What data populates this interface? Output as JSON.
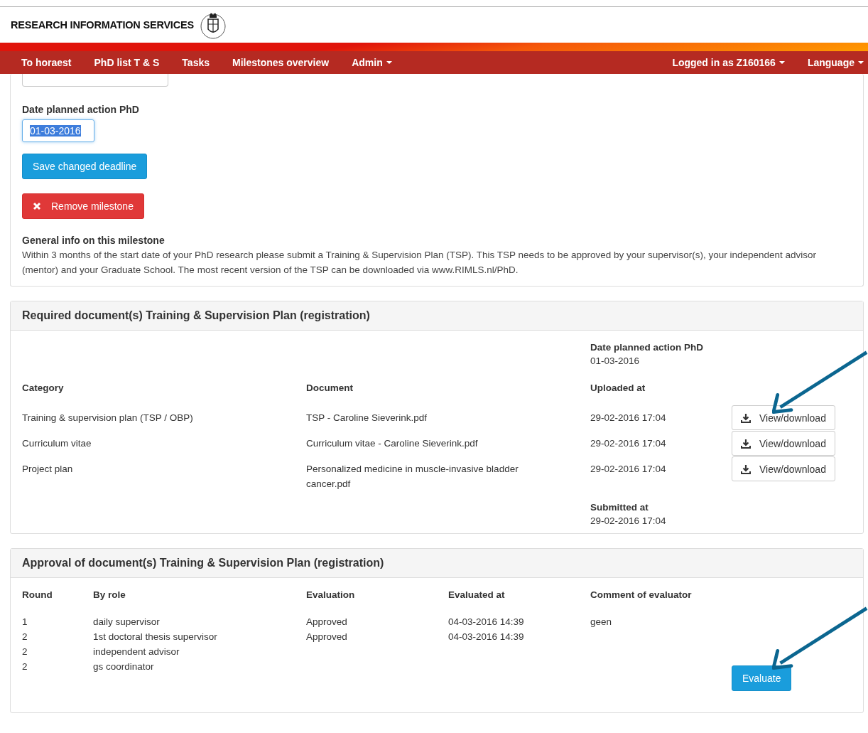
{
  "header": {
    "title": "RESEARCH INFORMATION SERVICES"
  },
  "nav": {
    "left": [
      {
        "label": "To horaest",
        "dropdown": false
      },
      {
        "label": "PhD list T & S",
        "dropdown": false
      },
      {
        "label": "Tasks",
        "dropdown": false
      },
      {
        "label": "Milestones overview",
        "dropdown": false
      },
      {
        "label": "Admin",
        "dropdown": true
      }
    ],
    "right": [
      {
        "label": "Logged in as Z160166",
        "dropdown": true
      },
      {
        "label": "Language",
        "dropdown": true
      }
    ]
  },
  "milestone": {
    "date_label": "Date planned action PhD",
    "date_value": "01-03-2016",
    "value_selected": true,
    "save_button": "Save changed deadline",
    "remove_button": "Remove milestone",
    "info_title": "General info on this milestone",
    "info_text": "Within 3 months of the start date of your PhD research please submit a Training & Supervision Plan (TSP). This TSP needs to be approved by your supervisor(s), your independent advisor (mentor) and your Graduate School. The most recent version of the TSP can be downloaded via www.RIMLS.nl/PhD."
  },
  "documents": {
    "title": "Required document(s) Training & Supervision Plan (registration)",
    "date_planned": {
      "label": "Date planned action PhD",
      "value": "01-03-2016"
    },
    "columns": [
      "Category",
      "Document",
      "Uploaded at"
    ],
    "rows": [
      {
        "category": "Training & supervision plan (TSP / OBP)",
        "document": "TSP - Caroline Sieverink.pdf",
        "uploaded_at": "29-02-2016 17:04",
        "action": "View/download"
      },
      {
        "category": "Curriculum vitae",
        "document": "Curriculum vitae - Caroline Sieverink.pdf",
        "uploaded_at": "29-02-2016 17:04",
        "action": "View/download"
      },
      {
        "category": "Project plan",
        "document": "Personalized medicine in muscle-invasive bladder cancer.pdf",
        "uploaded_at": "29-02-2016 17:04",
        "action": "View/download"
      }
    ],
    "submitted": {
      "label": "Submitted at",
      "value": "29-02-2016 17:04"
    }
  },
  "approval": {
    "title": "Approval of document(s) Training & Supervision Plan (registration)",
    "columns": [
      "Round",
      "By role",
      "Evaluation",
      "Evaluated at",
      "Comment of evaluator"
    ],
    "rows": [
      {
        "round": "1",
        "role": "daily supervisor",
        "evaluation": "Approved",
        "evaluated_at": "04-03-2016 14:39",
        "comment": "geen"
      },
      {
        "round": "2",
        "role": "1st doctoral thesis supervisor",
        "evaluation": "Approved",
        "evaluated_at": "04-03-2016 14:39"
      },
      {
        "round": "2",
        "role": "independent advisor"
      },
      {
        "round": "2",
        "role": "gs coordinator"
      }
    ],
    "evaluate_button": "Evaluate"
  }
}
